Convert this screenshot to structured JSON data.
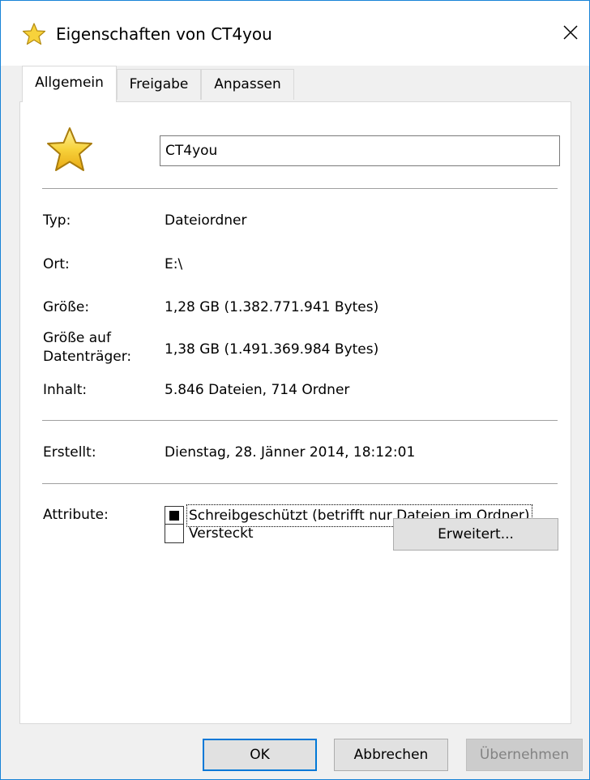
{
  "window": {
    "title": "Eigenschaften von CT4you",
    "close_symbol": "✕"
  },
  "tabs": [
    {
      "label": "Allgemein",
      "active": true
    },
    {
      "label": "Freigabe",
      "active": false
    },
    {
      "label": "Anpassen",
      "active": false
    }
  ],
  "folder": {
    "icon": "star-folder-icon",
    "name": "CT4you"
  },
  "properties": {
    "type_label": "Typ:",
    "type_value": "Dateiordner",
    "location_label": "Ort:",
    "location_value": "E:\\",
    "size_label": "Größe:",
    "size_value": "1,28 GB (1.382.771.941 Bytes)",
    "disk_size_label_line1": "Größe auf",
    "disk_size_label_line2": "Datenträger:",
    "disk_size_value": "1,38 GB (1.491.369.984 Bytes)",
    "content_label": "Inhalt:",
    "content_value": "5.846 Dateien, 714 Ordner",
    "created_label": "Erstellt:",
    "created_value": "Dienstag, 28. Jänner 2014, 18:12:01"
  },
  "attributes": {
    "label": "Attribute:",
    "readonly_label": "Schreibgeschützt (betrifft nur Dateien im Ordner)",
    "readonly_state": "indeterminate",
    "hidden_label": "Versteckt",
    "hidden_checked": false,
    "advanced_button": "Erweitert..."
  },
  "buttons": {
    "ok": "OK",
    "cancel": "Abbrechen",
    "apply": "Übernehmen"
  },
  "colors": {
    "accent": "#0078d7",
    "star": "#f7d23b"
  }
}
